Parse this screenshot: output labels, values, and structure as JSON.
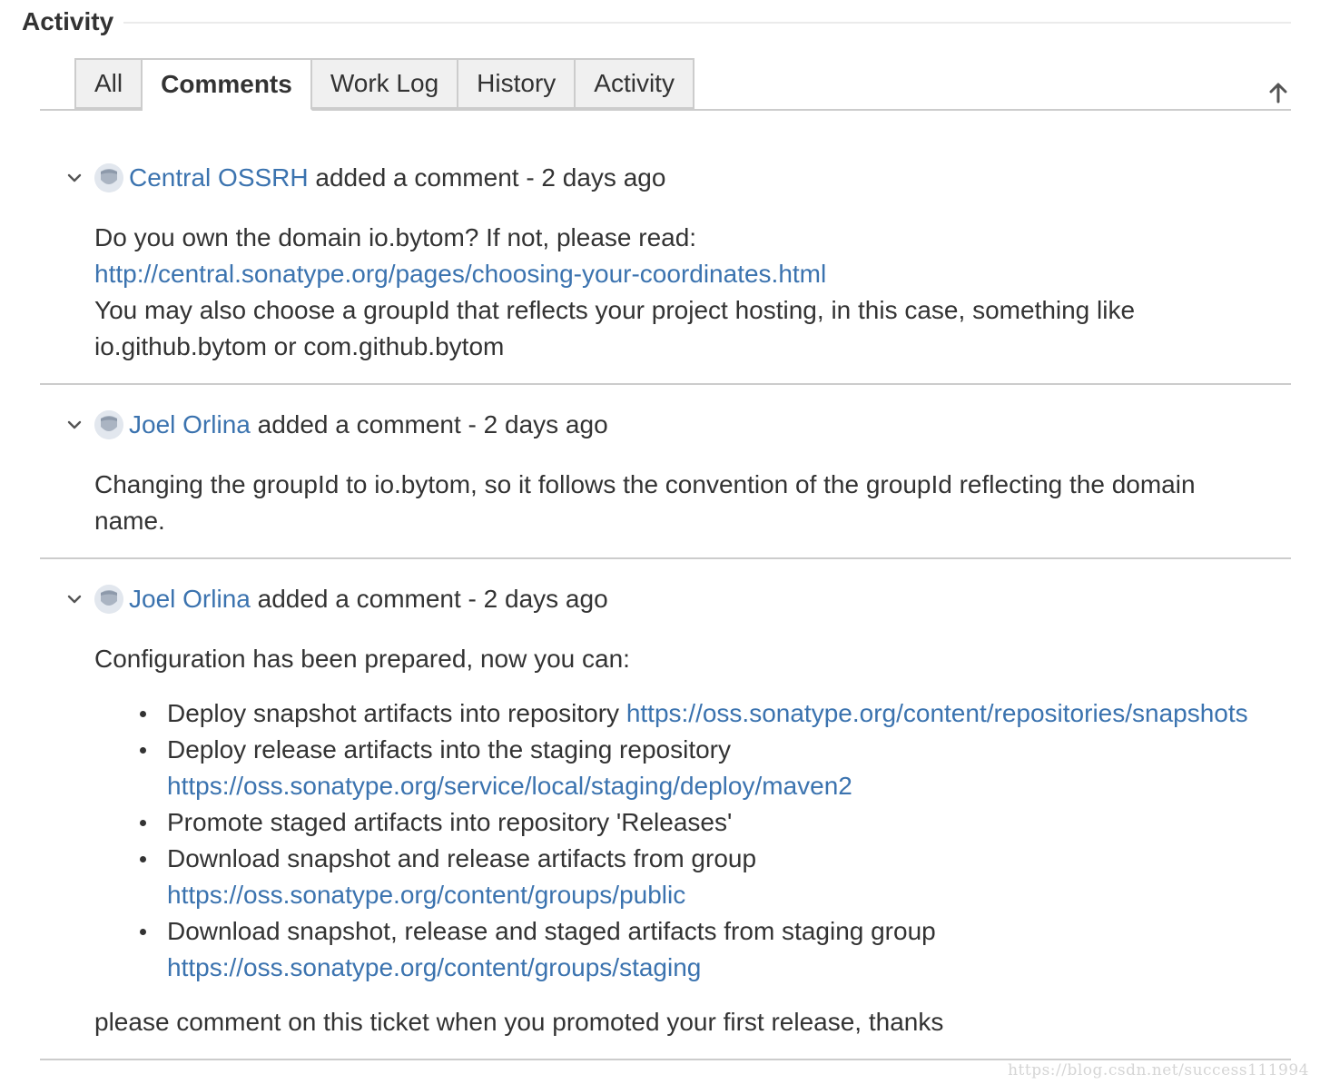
{
  "section": {
    "title": "Activity"
  },
  "tabs": [
    {
      "label": "All"
    },
    {
      "label": "Comments"
    },
    {
      "label": "Work Log"
    },
    {
      "label": "History"
    },
    {
      "label": "Activity"
    }
  ],
  "comments": [
    {
      "author": "Central OSSRH",
      "action": "added a comment - 2 days ago",
      "line1": "Do you own the domain io.bytom? If not, please read:",
      "link1": "http://central.sonatype.org/pages/choosing-your-coordinates.html",
      "line2": "You may also choose a groupId that reflects your project hosting, in this case, something like",
      "line3": "io.github.bytom or com.github.bytom"
    },
    {
      "author": "Joel Orlina",
      "action": "added a comment - 2 days ago",
      "line1": "Changing the groupId to io.bytom, so it follows the convention of the groupId reflecting the domain",
      "line2": "name."
    },
    {
      "author": "Joel Orlina",
      "action": "added a comment - 2 days ago",
      "intro": "Configuration has been prepared, now you can:",
      "items": [
        {
          "text": "Deploy snapshot artifacts into repository",
          "link": "https://oss.sonatype.org/content/repositories/snapshots"
        },
        {
          "text": "Deploy release artifacts into the staging repository",
          "link": "https://oss.sonatype.org/service/local/staging/deploy/maven2"
        },
        {
          "text": "Promote staged artifacts into repository 'Releases'"
        },
        {
          "text": "Download snapshot and release artifacts from group",
          "link": "https://oss.sonatype.org/content/groups/public"
        },
        {
          "text": "Download snapshot, release and staged artifacts from staging group",
          "link": "https://oss.sonatype.org/content/groups/staging"
        }
      ],
      "outro": "please comment on this ticket when you promoted your first release, thanks"
    }
  ],
  "watermark": "https://blog.csdn.net/success111994",
  "colors": {
    "link": "#3b73af",
    "text": "#333333",
    "tab_bg": "#f0f0f0",
    "border": "#cccccc"
  },
  "icons": {
    "sort": "arrow-up-icon",
    "toggle": "chevron-down-icon",
    "avatar": "user-avatar-icon"
  }
}
